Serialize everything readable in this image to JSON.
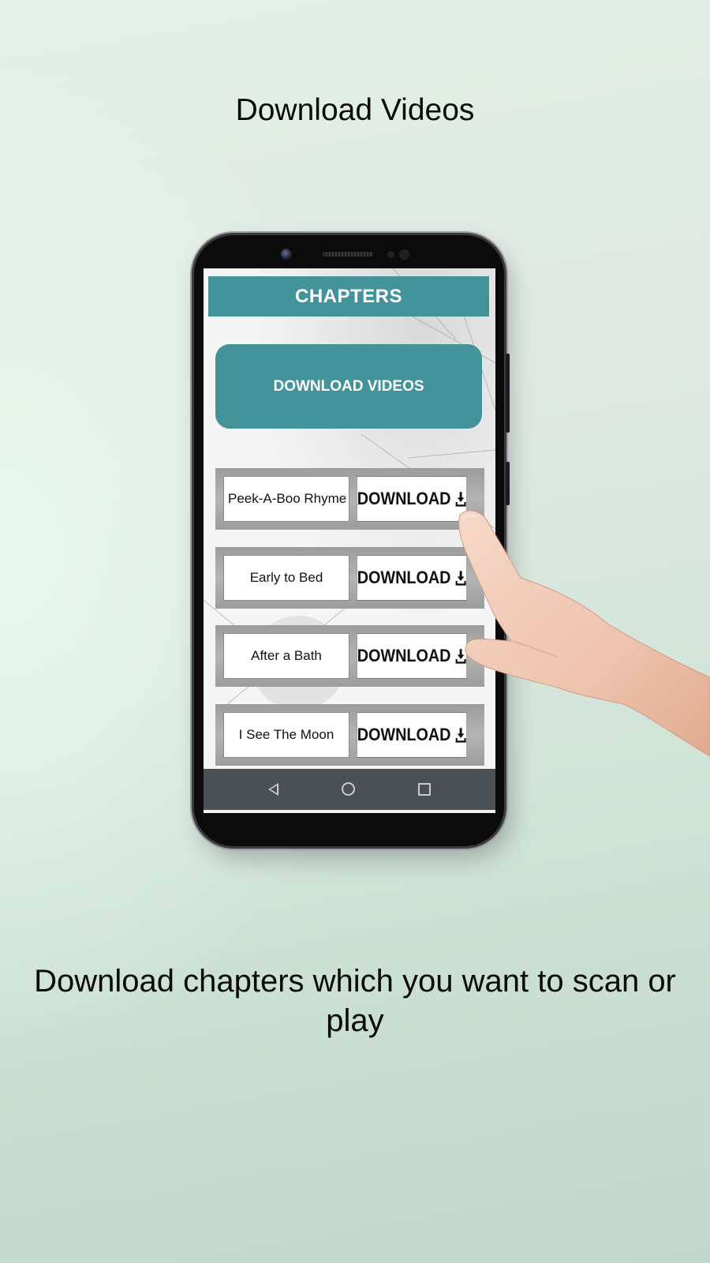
{
  "headline": "Download Videos",
  "caption": "Download chapters which you want to scan or play",
  "app": {
    "title": "CHAPTERS",
    "download_videos_label": "DOWNLOAD VIDEOS",
    "chapters": [
      {
        "name": "Peek-A-Boo Rhyme",
        "button": "DOWNLOAD"
      },
      {
        "name": "Early to Bed",
        "button": "DOWNLOAD"
      },
      {
        "name": "After a Bath",
        "button": "DOWNLOAD"
      },
      {
        "name": "I See The Moon",
        "button": "DOWNLOAD"
      }
    ],
    "download_icon": "download-arrow-icon"
  },
  "nav": {
    "back_icon": "back-triangle-icon",
    "home_icon": "home-circle-icon",
    "recents_icon": "recents-square-icon"
  },
  "colors": {
    "accent": "#42939a",
    "navbar": "#4a5054"
  }
}
